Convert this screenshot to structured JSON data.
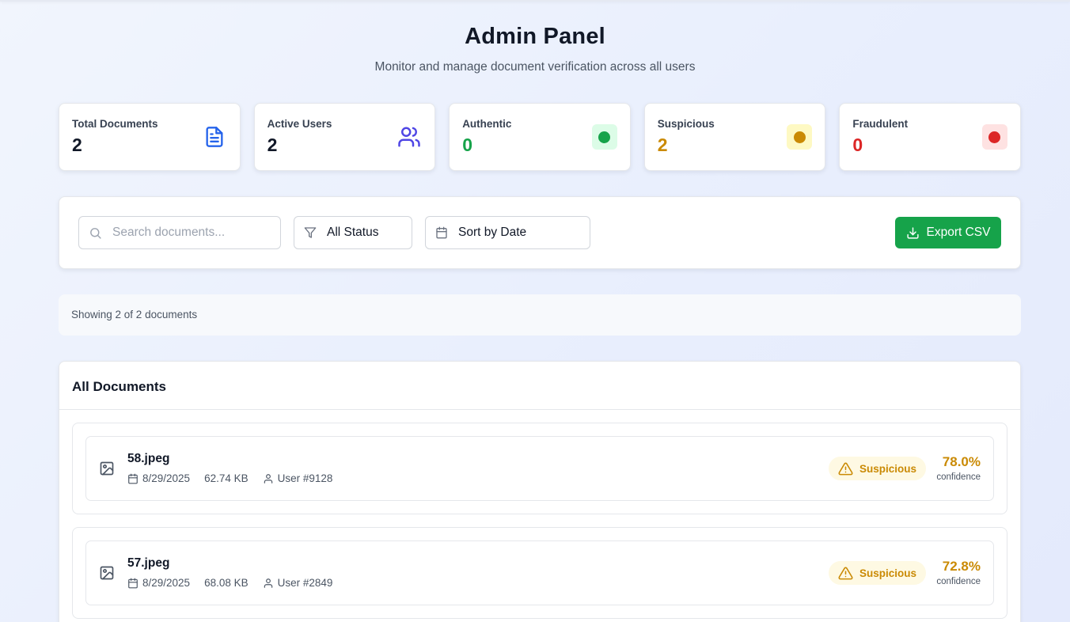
{
  "header": {
    "title": "Admin Panel",
    "subtitle": "Monitor and manage document verification across all users"
  },
  "stats": [
    {
      "label": "Total Documents",
      "value": "2",
      "icon": "document-icon",
      "color": "#111827"
    },
    {
      "label": "Active Users",
      "value": "2",
      "icon": "users-icon",
      "color": "#111827"
    },
    {
      "label": "Authentic",
      "value": "0",
      "icon": "green-dot-icon",
      "color": "#16a34a"
    },
    {
      "label": "Suspicious",
      "value": "2",
      "icon": "yellow-dot-icon",
      "color": "#ca8a04"
    },
    {
      "label": "Fraudulent",
      "value": "0",
      "icon": "red-dot-icon",
      "color": "#dc2626"
    }
  ],
  "filters": {
    "search_placeholder": "Search documents...",
    "status_value": "All Status",
    "sort_value": "Sort by Date",
    "export_label": "Export CSV"
  },
  "summary": {
    "showing_text": "Showing 2 of 2 documents"
  },
  "documents": {
    "heading": "All Documents",
    "items": [
      {
        "name": "58.jpeg",
        "date": "8/29/2025",
        "size": "62.74 KB",
        "user": "User #9128",
        "status": "Suspicious",
        "confidence": "78.0%",
        "confidence_label": "confidence"
      },
      {
        "name": "57.jpeg",
        "date": "8/29/2025",
        "size": "68.08 KB",
        "user": "User #2849",
        "status": "Suspicious",
        "confidence": "72.8%",
        "confidence_label": "confidence"
      }
    ]
  },
  "colors": {
    "accent_green": "#16a34a",
    "suspicious": "#ca8a04",
    "fraud": "#dc2626",
    "doc_icon_blue": "#2563eb",
    "users_icon_indigo": "#4f46e5"
  }
}
